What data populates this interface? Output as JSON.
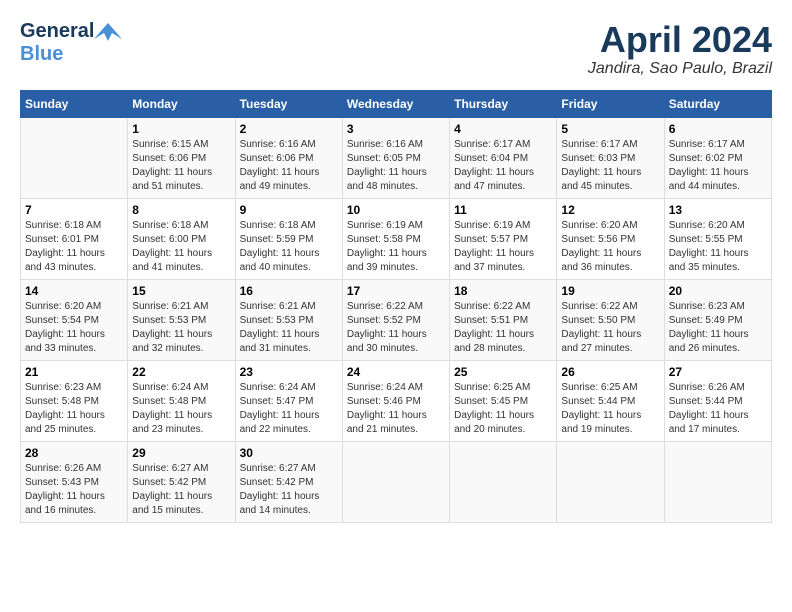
{
  "header": {
    "logo_general": "General",
    "logo_blue": "Blue",
    "month_title": "April 2024",
    "location": "Jandira, Sao Paulo, Brazil"
  },
  "columns": [
    "Sunday",
    "Monday",
    "Tuesday",
    "Wednesday",
    "Thursday",
    "Friday",
    "Saturday"
  ],
  "weeks": [
    {
      "days": [
        {
          "num": "",
          "info": ""
        },
        {
          "num": "1",
          "info": "Sunrise: 6:15 AM\nSunset: 6:06 PM\nDaylight: 11 hours\nand 51 minutes."
        },
        {
          "num": "2",
          "info": "Sunrise: 6:16 AM\nSunset: 6:06 PM\nDaylight: 11 hours\nand 49 minutes."
        },
        {
          "num": "3",
          "info": "Sunrise: 6:16 AM\nSunset: 6:05 PM\nDaylight: 11 hours\nand 48 minutes."
        },
        {
          "num": "4",
          "info": "Sunrise: 6:17 AM\nSunset: 6:04 PM\nDaylight: 11 hours\nand 47 minutes."
        },
        {
          "num": "5",
          "info": "Sunrise: 6:17 AM\nSunset: 6:03 PM\nDaylight: 11 hours\nand 45 minutes."
        },
        {
          "num": "6",
          "info": "Sunrise: 6:17 AM\nSunset: 6:02 PM\nDaylight: 11 hours\nand 44 minutes."
        }
      ]
    },
    {
      "days": [
        {
          "num": "7",
          "info": "Sunrise: 6:18 AM\nSunset: 6:01 PM\nDaylight: 11 hours\nand 43 minutes."
        },
        {
          "num": "8",
          "info": "Sunrise: 6:18 AM\nSunset: 6:00 PM\nDaylight: 11 hours\nand 41 minutes."
        },
        {
          "num": "9",
          "info": "Sunrise: 6:18 AM\nSunset: 5:59 PM\nDaylight: 11 hours\nand 40 minutes."
        },
        {
          "num": "10",
          "info": "Sunrise: 6:19 AM\nSunset: 5:58 PM\nDaylight: 11 hours\nand 39 minutes."
        },
        {
          "num": "11",
          "info": "Sunrise: 6:19 AM\nSunset: 5:57 PM\nDaylight: 11 hours\nand 37 minutes."
        },
        {
          "num": "12",
          "info": "Sunrise: 6:20 AM\nSunset: 5:56 PM\nDaylight: 11 hours\nand 36 minutes."
        },
        {
          "num": "13",
          "info": "Sunrise: 6:20 AM\nSunset: 5:55 PM\nDaylight: 11 hours\nand 35 minutes."
        }
      ]
    },
    {
      "days": [
        {
          "num": "14",
          "info": "Sunrise: 6:20 AM\nSunset: 5:54 PM\nDaylight: 11 hours\nand 33 minutes."
        },
        {
          "num": "15",
          "info": "Sunrise: 6:21 AM\nSunset: 5:53 PM\nDaylight: 11 hours\nand 32 minutes."
        },
        {
          "num": "16",
          "info": "Sunrise: 6:21 AM\nSunset: 5:53 PM\nDaylight: 11 hours\nand 31 minutes."
        },
        {
          "num": "17",
          "info": "Sunrise: 6:22 AM\nSunset: 5:52 PM\nDaylight: 11 hours\nand 30 minutes."
        },
        {
          "num": "18",
          "info": "Sunrise: 6:22 AM\nSunset: 5:51 PM\nDaylight: 11 hours\nand 28 minutes."
        },
        {
          "num": "19",
          "info": "Sunrise: 6:22 AM\nSunset: 5:50 PM\nDaylight: 11 hours\nand 27 minutes."
        },
        {
          "num": "20",
          "info": "Sunrise: 6:23 AM\nSunset: 5:49 PM\nDaylight: 11 hours\nand 26 minutes."
        }
      ]
    },
    {
      "days": [
        {
          "num": "21",
          "info": "Sunrise: 6:23 AM\nSunset: 5:48 PM\nDaylight: 11 hours\nand 25 minutes."
        },
        {
          "num": "22",
          "info": "Sunrise: 6:24 AM\nSunset: 5:48 PM\nDaylight: 11 hours\nand 23 minutes."
        },
        {
          "num": "23",
          "info": "Sunrise: 6:24 AM\nSunset: 5:47 PM\nDaylight: 11 hours\nand 22 minutes."
        },
        {
          "num": "24",
          "info": "Sunrise: 6:24 AM\nSunset: 5:46 PM\nDaylight: 11 hours\nand 21 minutes."
        },
        {
          "num": "25",
          "info": "Sunrise: 6:25 AM\nSunset: 5:45 PM\nDaylight: 11 hours\nand 20 minutes."
        },
        {
          "num": "26",
          "info": "Sunrise: 6:25 AM\nSunset: 5:44 PM\nDaylight: 11 hours\nand 19 minutes."
        },
        {
          "num": "27",
          "info": "Sunrise: 6:26 AM\nSunset: 5:44 PM\nDaylight: 11 hours\nand 17 minutes."
        }
      ]
    },
    {
      "days": [
        {
          "num": "28",
          "info": "Sunrise: 6:26 AM\nSunset: 5:43 PM\nDaylight: 11 hours\nand 16 minutes."
        },
        {
          "num": "29",
          "info": "Sunrise: 6:27 AM\nSunset: 5:42 PM\nDaylight: 11 hours\nand 15 minutes."
        },
        {
          "num": "30",
          "info": "Sunrise: 6:27 AM\nSunset: 5:42 PM\nDaylight: 11 hours\nand 14 minutes."
        },
        {
          "num": "",
          "info": ""
        },
        {
          "num": "",
          "info": ""
        },
        {
          "num": "",
          "info": ""
        },
        {
          "num": "",
          "info": ""
        }
      ]
    }
  ]
}
